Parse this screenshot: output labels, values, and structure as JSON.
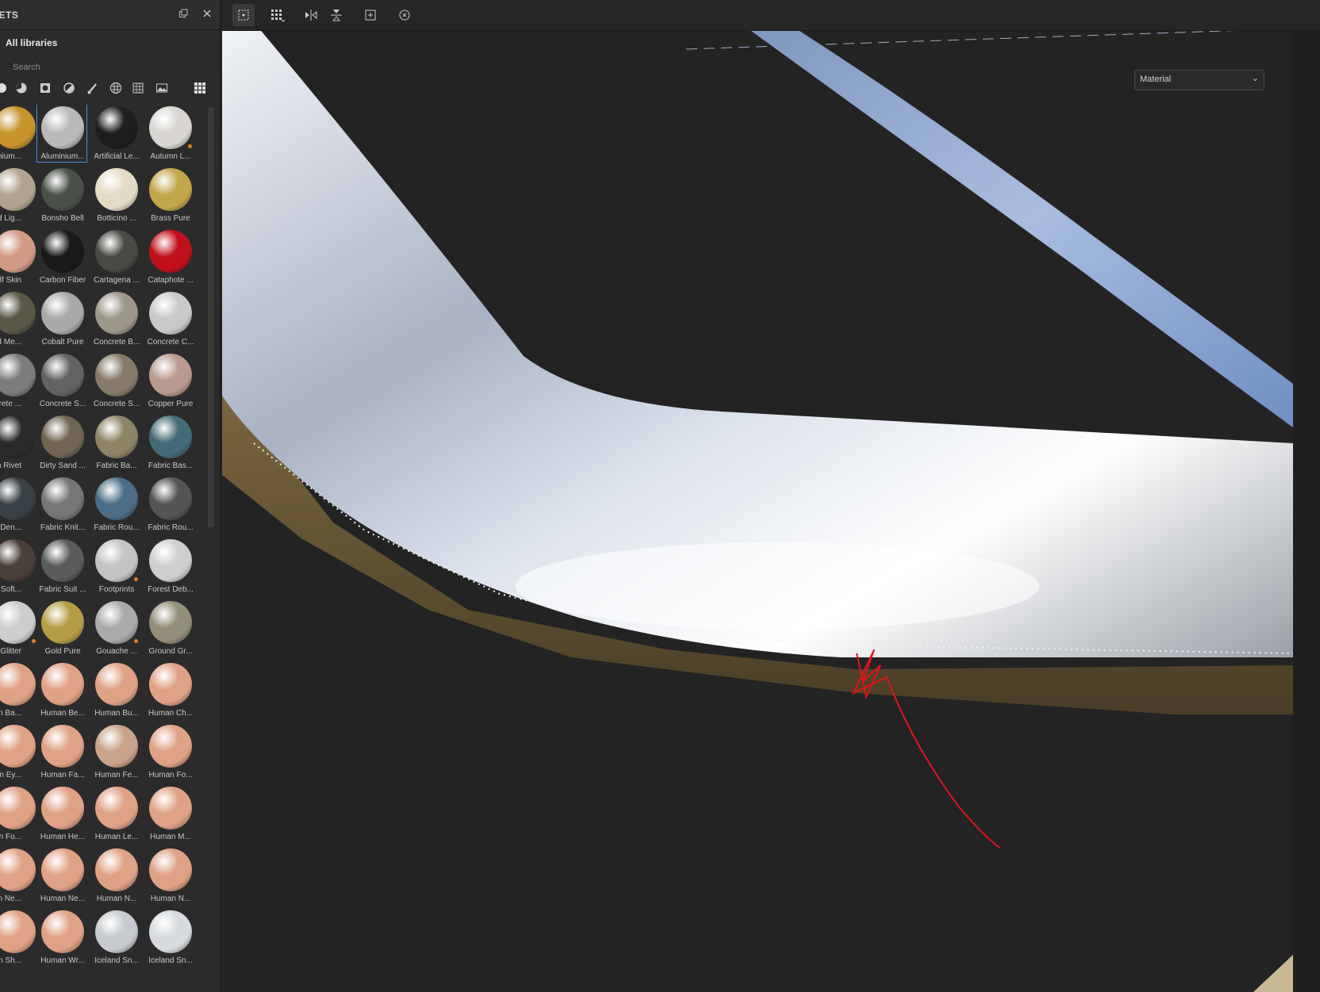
{
  "panel": {
    "title": "SETS",
    "library": "All libraries",
    "search_placeholder": "Search"
  },
  "viewport": {
    "material_select": "Material"
  },
  "materials": [
    {
      "label": "minium...",
      "color": "#c7932d"
    },
    {
      "label": "Aluminium...",
      "color": "#b9b9b9",
      "selected": true
    },
    {
      "label": "Artificial Le...",
      "color": "#1e1e1e"
    },
    {
      "label": "Autumn L...",
      "color": "#d9d6d2",
      "dot": "#e0811f"
    },
    {
      "label": "ked Lig...",
      "color": "#b1a48e"
    },
    {
      "label": "Bonsho Bell",
      "color": "#4a5148"
    },
    {
      "label": "Botticino ...",
      "color": "#e3dbc4"
    },
    {
      "label": "Brass Pure",
      "color": "#c2a64b"
    },
    {
      "label": "alf Skin",
      "color": "#d29a86"
    },
    {
      "label": "Carbon Fiber",
      "color": "#1a1a1a"
    },
    {
      "label": "Cartagena ...",
      "color": "#4a4a44"
    },
    {
      "label": "Cataphote ...",
      "color": "#c0101c"
    },
    {
      "label": "ted Me...",
      "color": "#5a5746"
    },
    {
      "label": "Cobalt Pure",
      "color": "#a9a9a9"
    },
    {
      "label": "Concrete B...",
      "color": "#9c9788"
    },
    {
      "label": "Concrete C...",
      "color": "#c9c9c9"
    },
    {
      "label": "ncrete ...",
      "color": "#7c7c7c"
    },
    {
      "label": "Concrete S...",
      "color": "#636363"
    },
    {
      "label": "Concrete S...",
      "color": "#857b68"
    },
    {
      "label": "Copper Pure",
      "color": "#b99a8e"
    },
    {
      "label": "him Rivet",
      "color": "#2c2a28"
    },
    {
      "label": "Dirty Sand ...",
      "color": "#6f6552"
    },
    {
      "label": "Fabric Ba...",
      "color": "#8d8466"
    },
    {
      "label": "Fabric Bas...",
      "color": "#466b78"
    },
    {
      "label": "ric Den...",
      "color": "#3a4146"
    },
    {
      "label": "Fabric Knit...",
      "color": "#767676"
    },
    {
      "label": "Fabric Rou...",
      "color": "#4c6d85"
    },
    {
      "label": "Fabric Rou...",
      "color": "#545454"
    },
    {
      "label": "ric Soft...",
      "color": "#4a3f39"
    },
    {
      "label": "Fabric Suit ...",
      "color": "#5b5b5b"
    },
    {
      "label": "Footprints",
      "color": "#c3c3c3",
      "dot": "#e0811f"
    },
    {
      "label": "Forest Deb...",
      "color": "#cfcfcf"
    },
    {
      "label": "Glitter",
      "color": "#cdcdcd",
      "dot": "#e0811f"
    },
    {
      "label": "Gold Pure",
      "color": "#b59d45"
    },
    {
      "label": "Gouache ...",
      "color": "#aaaaaa",
      "dot": "#e0811f"
    },
    {
      "label": "Ground Gr...",
      "color": "#938e7a"
    },
    {
      "label": "nan Ba...",
      "color": "#e0a286"
    },
    {
      "label": "Human Be...",
      "color": "#e0a286"
    },
    {
      "label": "Human Bu...",
      "color": "#e0a286"
    },
    {
      "label": "Human Ch...",
      "color": "#e0a286"
    },
    {
      "label": "nan Ey...",
      "color": "#e0a286"
    },
    {
      "label": "Human Fa...",
      "color": "#e0a286"
    },
    {
      "label": "Human Fe...",
      "color": "#c9a38c"
    },
    {
      "label": "Human Fo...",
      "color": "#e0a286"
    },
    {
      "label": "nan Fo...",
      "color": "#e0a286"
    },
    {
      "label": "Human He...",
      "color": "#e0a286"
    },
    {
      "label": "Human Le...",
      "color": "#e0a286"
    },
    {
      "label": "Human M...",
      "color": "#e0a286"
    },
    {
      "label": "nan Ne...",
      "color": "#e0a286"
    },
    {
      "label": "Human Ne...",
      "color": "#e0a286"
    },
    {
      "label": "Human N...",
      "color": "#e0a286"
    },
    {
      "label": "Human N...",
      "color": "#e0a286"
    },
    {
      "label": "nan Sh...",
      "color": "#e0a286"
    },
    {
      "label": "Human Wr...",
      "color": "#e0a286"
    },
    {
      "label": "Iceland Sn...",
      "color": "#c7cbcf"
    },
    {
      "label": "Iceland Sn...",
      "color": "#d7dbdf"
    }
  ]
}
